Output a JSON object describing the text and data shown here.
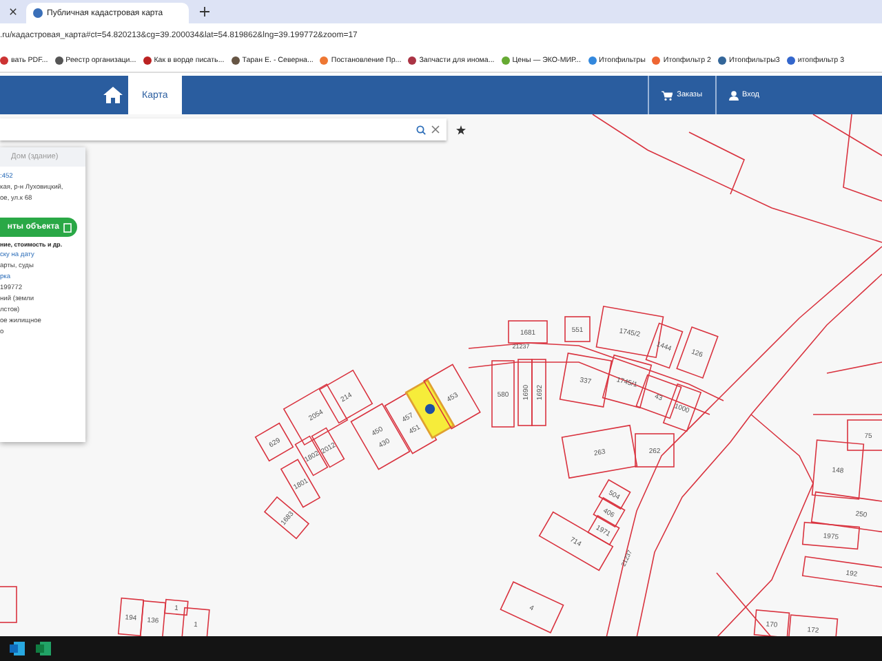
{
  "browser": {
    "tabs": [
      {
        "title": "Публичная кадастровая карта",
        "selected": true
      }
    ],
    "url": ".ru/кадастровая_карта#ct=54.820213&cg=39.200034&lat=54.819862&lng=39.199772&zoom=17",
    "bookmarks": [
      "вать PDF...",
      "Реестр организаци...",
      "Как в ворде писать...",
      "Таран Е. - Северна...",
      "Постановление Пр...",
      "Запчасти для инома...",
      "Цены — ЭКО-МИР...",
      "Итопфильтры",
      "Итопфильтр 2",
      "Итопфильтры3",
      "итопфильтр 3"
    ]
  },
  "header": {
    "nav": [
      {
        "label": "Карта",
        "selected": true
      }
    ],
    "actions": [
      "Заказы",
      "Вход"
    ]
  },
  "panel": {
    "title": "Дом (здание)",
    "items": [
      {
        "kind": "link",
        "text": ":452"
      },
      {
        "kind": "text",
        "text": "кая, р-н Луховицкий,"
      },
      {
        "kind": "text",
        "text": "ое, ул.к 68"
      },
      {
        "kind": "button",
        "text": "нты объекта"
      },
      {
        "kind": "note",
        "text": "ние, стоимость и др."
      },
      {
        "kind": "link",
        "text": "ску на дату"
      },
      {
        "kind": "text",
        "text": "арты, суды"
      },
      {
        "kind": "link",
        "text": "рка"
      },
      {
        "kind": "text",
        "text": "199772"
      },
      {
        "kind": "text",
        "text": "ний (земли"
      },
      {
        "kind": "text",
        "text": "лстов)"
      },
      {
        "kind": "text",
        "text": "ое жилищное"
      },
      {
        "kind": "text",
        "text": "о"
      }
    ]
  },
  "map": {
    "parcels": [
      {
        "labels": [
          "1681"
        ],
        "selected": false
      },
      {
        "labels": [
          "551"
        ],
        "selected": false
      },
      {
        "labels": [
          "1745/2"
        ],
        "selected": false
      },
      {
        "labels": [
          "337"
        ],
        "selected": false
      },
      {
        "labels": [
          "1745/1"
        ],
        "selected": false
      },
      {
        "labels": [
          "43"
        ],
        "selected": false
      },
      {
        "labels": [
          "1444"
        ],
        "selected": false
      },
      {
        "labels": [
          "126"
        ],
        "selected": false
      },
      {
        "labels": [
          "1000"
        ],
        "selected": false
      },
      {
        "labels": [
          "263"
        ],
        "selected": false
      },
      {
        "labels": [
          "262"
        ],
        "selected": false
      },
      {
        "labels": [
          "504"
        ],
        "selected": false
      },
      {
        "labels": [
          "406"
        ],
        "selected": false
      },
      {
        "labels": [
          "1971"
        ],
        "selected": false
      },
      {
        "labels": [
          "714"
        ],
        "selected": false
      },
      {
        "labels": [
          "2054"
        ],
        "selected": false
      },
      {
        "labels": [
          "214"
        ],
        "selected": false
      },
      {
        "labels": [
          "629"
        ],
        "selected": false
      },
      {
        "labels": [
          "1802"
        ],
        "selected": false
      },
      {
        "labels": [
          "2012"
        ],
        "selected": false
      },
      {
        "labels": [
          "450",
          "430"
        ],
        "selected": false
      },
      {
        "labels": [
          "457",
          "451"
        ],
        "selected": false
      },
      {
        "selected": true
      },
      {
        "labels": [
          "453"
        ],
        "selected": false
      },
      {
        "labels": [
          "1801"
        ],
        "selected": false
      },
      {
        "labels": [
          "1683"
        ],
        "selected": false
      },
      {
        "labels": [
          "580"
        ],
        "selected": false
      },
      {
        "labels": [
          "1690"
        ],
        "selected": false
      },
      {
        "labels": [
          "1692"
        ],
        "selected": false
      },
      {
        "labels": [
          "75"
        ],
        "selected": false
      },
      {
        "labels": [
          "148"
        ],
        "selected": false
      },
      {
        "labels": [
          "250"
        ],
        "selected": false
      },
      {
        "labels": [
          "1975"
        ],
        "selected": false
      },
      {
        "labels": [
          "192"
        ],
        "selected": false
      },
      {
        "labels": [
          "4"
        ],
        "selected": false
      },
      {
        "labels": [
          "170"
        ],
        "selected": false
      },
      {
        "labels": [
          "172"
        ],
        "selected": false
      },
      {
        "labels": [
          "194"
        ],
        "selected": false
      },
      {
        "labels": [
          "136"
        ],
        "selected": false
      },
      {
        "labels": [
          "1"
        ],
        "selected": false
      },
      {
        "labels": [
          "1"
        ],
        "selected": false
      },
      {
        "selected": false
      }
    ],
    "road_labels": [
      "21237",
      "21237"
    ]
  }
}
